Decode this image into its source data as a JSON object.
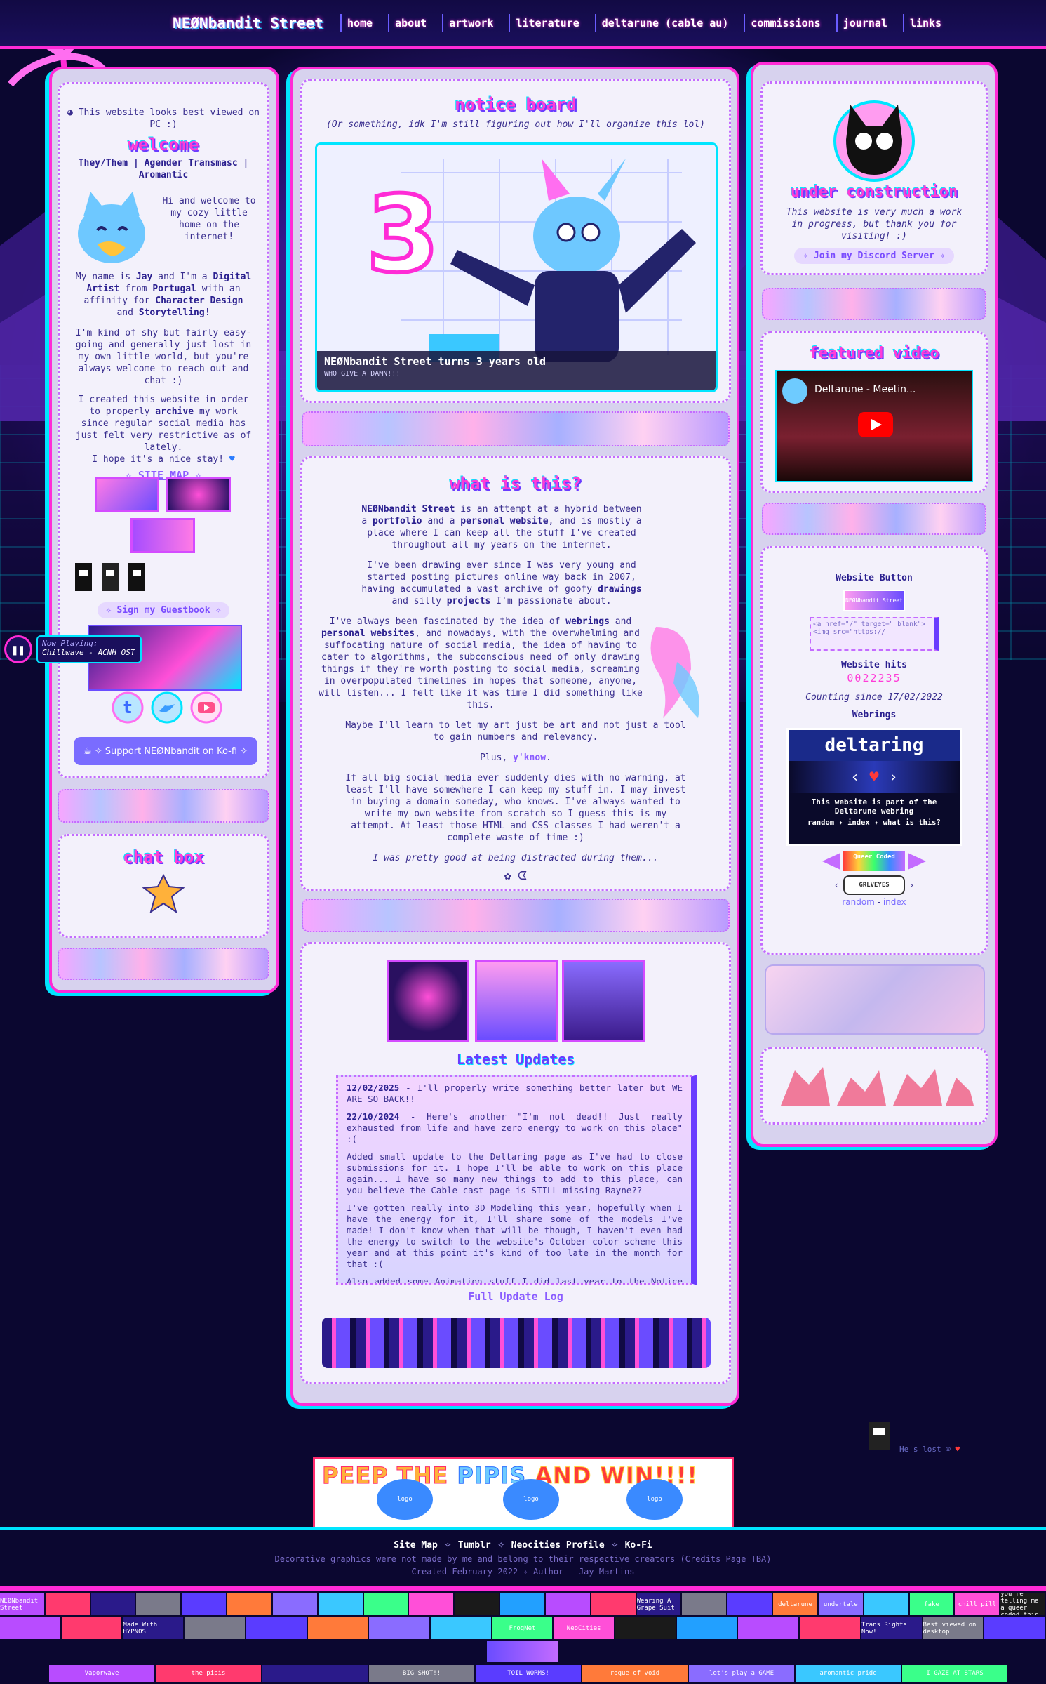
{
  "nav": {
    "site_name": "NEØNbandit Street",
    "items": [
      "home",
      "about",
      "artwork",
      "literature",
      "deltarune (cable au)",
      "commissions",
      "journal",
      "links"
    ]
  },
  "left": {
    "best_viewed": "This website looks best viewed on PC :)",
    "welcome_title": "welcome",
    "identity": "They/Them | Agender Transmasc | Aromantic",
    "intro": "Hi and welcome to my cozy little home on the internet!",
    "name_line_1": "My name is ",
    "name": "Jay",
    "name_line_2": " and I'm a ",
    "artist_role": "Digital Artist",
    "from": " from ",
    "country": "Portugal",
    "affinity_1": " with an affinity for ",
    "affinity_a": "Character Design",
    "affinity_and": " and ",
    "affinity_b": "Storytelling",
    "affinity_end": "!",
    "shy": "I'm kind of shy but fairly easy-going and generally just lost in my own little world, but you're always welcome to reach out and chat :)",
    "archive_1": "I created this website in order to properly ",
    "archive_word": "archive",
    "archive_2": " my work since regular social media has just felt very restrictive as of lately.",
    "hope": "I hope it's a nice stay!",
    "site_map": "✧ SITE MAP ✧",
    "guestbook": "✧ Sign my Guestbook ✧",
    "now_playing_label": "Now Playing:",
    "now_playing_track": "Chillwave - ACNH OST",
    "kofi": "✧ Support NEØNbandit on Ko-fi ✧",
    "chatbox_title": "chat box"
  },
  "center": {
    "notice_title": "notice board",
    "notice_sub": "(Or something, idk I'm still figuring out how I'll organize this lol)",
    "notice_caption": "NEØNbandit Street turns 3 years old",
    "notice_caption_sub": "WHO GIVE A DAMN!!!",
    "what_title": "what is this?",
    "what_p1_a": "NEØNbandit Street",
    "what_p1_b": " is an attempt at a hybrid between a ",
    "what_p1_c": "portfolio",
    "what_p1_d": " and a ",
    "what_p1_e": "personal website",
    "what_p1_f": ", and is mostly a place where I can keep all the stuff I've created throughout all my years on the internet.",
    "what_p2_a": "I've been drawing ever since I was very young and started posting pictures online way back in 2007, having accumulated a vast archive of goofy ",
    "what_p2_b": "drawings",
    "what_p2_c": " and silly ",
    "what_p2_d": "projects",
    "what_p2_e": " I'm passionate about.",
    "what_p3_a": "I've always been fascinated by the idea of ",
    "what_p3_b": "webrings",
    "what_p3_c": " and ",
    "what_p3_d": "personal websites",
    "what_p3_e": ", and nowadays, with the overwhelming and suffocating nature of social media, the idea of having to cater to algorithms, the subconscious need of only drawing things if they're worth posting to social media, screaming in overpopulated timelines in hopes that someone, anyone, will listen... I felt like it was time I did something like this.",
    "what_p4": "Maybe I'll learn to let my art just be art and not just a tool to gain numbers and relevancy.",
    "what_p5_a": "Plus, ",
    "what_p5_b": "y'know",
    "what_p5_c": ".",
    "what_p6": "If all big social media ever suddenly dies with no warning, at least I'll have somewhere I can keep my stuff in. I may invest in buying a domain someday, who knows. I've always wanted to write my own website from scratch so I guess this is my attempt. At least those HTML and CSS classes I had weren't a complete waste of time :)",
    "what_p7": "I was pretty good at being distracted during them...",
    "updates_title": "Latest Updates",
    "updates": [
      {
        "date": "12/02/2025",
        "text": " - I'll properly write something better later but WE ARE SO BACK!!"
      },
      {
        "date": "22/10/2024",
        "text": " - Here's another \"I'm not dead!! Just really exhausted from life and have zero energy to work on this place\" :("
      },
      {
        "date": "",
        "text": "Added small update to the Deltaring page as I've had to close submissions for it. I hope I'll be able to work on this place again... I have so many new things to add to this place, can you believe the Cable cast page is STILL missing Rayne??"
      },
      {
        "date": "",
        "text": "I've gotten really into 3D Modeling this year, hopefully when I have the energy for it, I'll share some of the models I've made! I don't know when that will be though, I haven't even had the energy to switch to the website's October color scheme this year and at this point it's kind of too late in the month for that :("
      },
      {
        "date": "",
        "text": "Also added some Animation stuff I did last year to the Notice Board so"
      }
    ],
    "full_log": "Full Update Log"
  },
  "right": {
    "construction_title": "under construction",
    "construction_text": "This website is very much a work in progress, but thank you for visiting! :)",
    "discord": "✧ Join my Discord Server ✧",
    "featured_title": "featured video",
    "video_title": "Deltarune - Meetin...",
    "website_button": "Website Button",
    "button_code": "<a href=\"/\" target=\"_blank\"><img src=\"https://",
    "hits_label": "Website hits",
    "hits": "0022235",
    "counting_since": "Counting since 17/02/2022",
    "webrings": "Webrings",
    "deltaring_title": "deltaring",
    "deltaring_text": "This website is part of the Deltarune webring",
    "deltaring_links": "random ✦ index ✦ what is this?",
    "queer_coded": "Queer Coded",
    "graveyard": "GRLVEYES",
    "random": "random",
    "dash": " - ",
    "index": "index"
  },
  "footer": {
    "lost": "He's lost",
    "links": [
      "Site Map",
      "Tumblr",
      "Neocities Profile",
      "Ko-Fi"
    ],
    "credits": "Decorative graphics were not made by me and belong to their respective creators (Credits Page TBA)",
    "created": "Created February 2022 ✧ Author - Jay Martins",
    "peep_a": "PEEP THE ",
    "peep_b": "PIPIS",
    "peep_c": " AND WIN!!!!",
    "logo": "logo",
    "buttons_row1": [
      "NEØNbandit Street",
      "",
      "",
      "",
      "",
      "",
      "",
      "",
      "",
      "",
      "",
      "",
      "",
      "",
      "Wearing A Grape Suit",
      "",
      "",
      "deltarune",
      "undertale",
      "",
      "fake",
      "chill pill",
      "you're telling me a queer coded this"
    ],
    "buttons_row2": [
      "",
      "",
      "Made With HYPNOS",
      "",
      "",
      "",
      "",
      "",
      "FrogNet",
      "NeoCities",
      "",
      "",
      "",
      "",
      "Trans Rights Now!",
      "Best viewed on desktop",
      ""
    ],
    "buttons_row3": [
      "Vaporwave",
      "the pipis",
      "",
      "BIG SHOT!!",
      "TOIL WORMS!",
      "rogue of void",
      "let's play a GAME",
      "aromantic pride",
      "I GAZE AT STARS"
    ]
  }
}
